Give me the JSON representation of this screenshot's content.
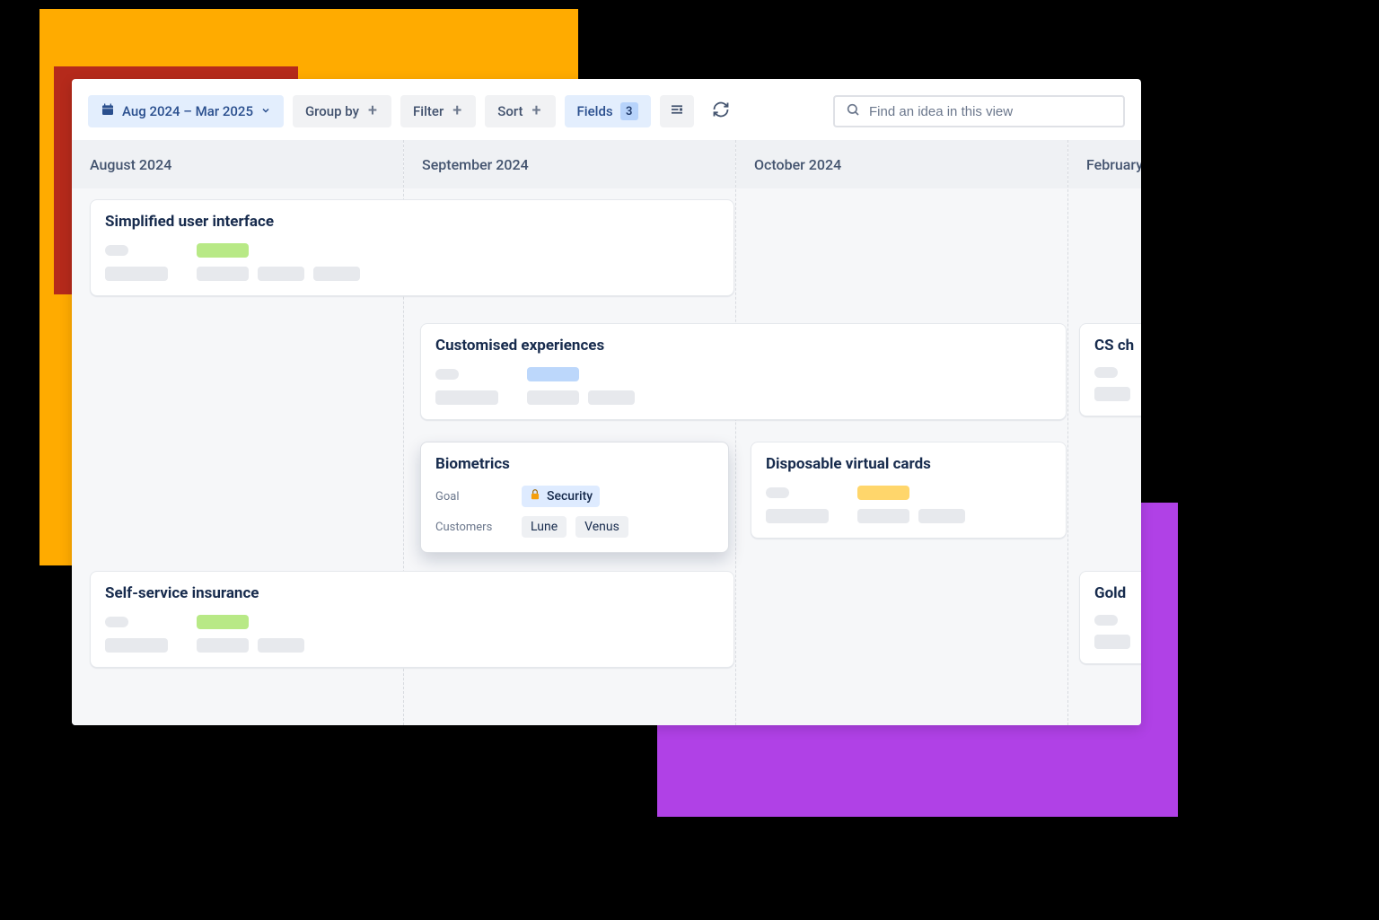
{
  "toolbar": {
    "date_range": "Aug 2024 – Mar 2025",
    "group_by": "Group by",
    "filter": "Filter",
    "sort": "Sort",
    "fields": "Fields",
    "fields_count": "3",
    "search_placeholder": "Find an idea in this view"
  },
  "columns": [
    {
      "label": "August 2024"
    },
    {
      "label": "September 2024"
    },
    {
      "label": "October 2024"
    },
    {
      "label": "February"
    }
  ],
  "cards": {
    "simplified_ui": {
      "title": "Simplified user interface"
    },
    "customised": {
      "title": "Customised experiences"
    },
    "biometrics": {
      "title": "Biometrics",
      "goal_label": "Goal",
      "goal_value": "Security",
      "customers_label": "Customers",
      "customers": [
        "Lune",
        "Venus"
      ]
    },
    "disposable": {
      "title": "Disposable virtual cards"
    },
    "self_service": {
      "title": "Self-service insurance"
    },
    "cs_ch": {
      "title": "CS ch"
    },
    "gold": {
      "title": "Gold "
    }
  }
}
